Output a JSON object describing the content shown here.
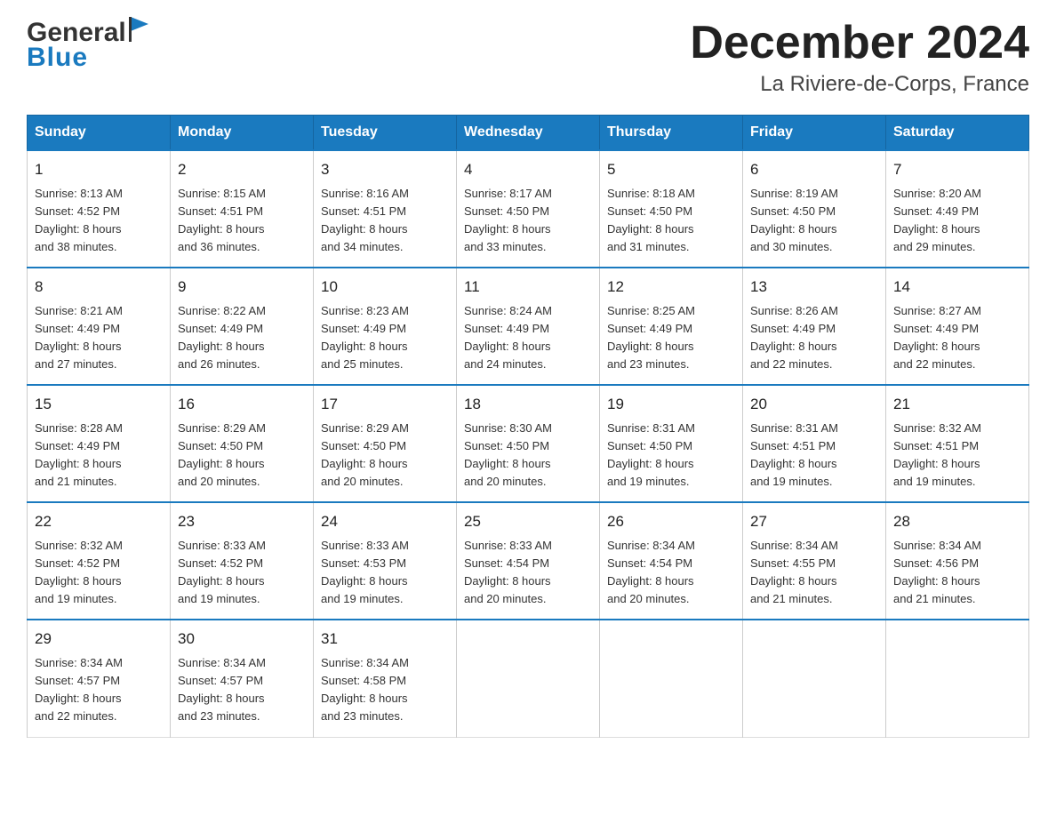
{
  "logo": {
    "general_text": "General",
    "blue_text": "Blue"
  },
  "title": "December 2024",
  "subtitle": "La Riviere-de-Corps, France",
  "weekdays": [
    "Sunday",
    "Monday",
    "Tuesday",
    "Wednesday",
    "Thursday",
    "Friday",
    "Saturday"
  ],
  "weeks": [
    [
      {
        "day": "1",
        "sunrise": "8:13 AM",
        "sunset": "4:52 PM",
        "daylight": "8 hours and 38 minutes."
      },
      {
        "day": "2",
        "sunrise": "8:15 AM",
        "sunset": "4:51 PM",
        "daylight": "8 hours and 36 minutes."
      },
      {
        "day": "3",
        "sunrise": "8:16 AM",
        "sunset": "4:51 PM",
        "daylight": "8 hours and 34 minutes."
      },
      {
        "day": "4",
        "sunrise": "8:17 AM",
        "sunset": "4:50 PM",
        "daylight": "8 hours and 33 minutes."
      },
      {
        "day": "5",
        "sunrise": "8:18 AM",
        "sunset": "4:50 PM",
        "daylight": "8 hours and 31 minutes."
      },
      {
        "day": "6",
        "sunrise": "8:19 AM",
        "sunset": "4:50 PM",
        "daylight": "8 hours and 30 minutes."
      },
      {
        "day": "7",
        "sunrise": "8:20 AM",
        "sunset": "4:49 PM",
        "daylight": "8 hours and 29 minutes."
      }
    ],
    [
      {
        "day": "8",
        "sunrise": "8:21 AM",
        "sunset": "4:49 PM",
        "daylight": "8 hours and 27 minutes."
      },
      {
        "day": "9",
        "sunrise": "8:22 AM",
        "sunset": "4:49 PM",
        "daylight": "8 hours and 26 minutes."
      },
      {
        "day": "10",
        "sunrise": "8:23 AM",
        "sunset": "4:49 PM",
        "daylight": "8 hours and 25 minutes."
      },
      {
        "day": "11",
        "sunrise": "8:24 AM",
        "sunset": "4:49 PM",
        "daylight": "8 hours and 24 minutes."
      },
      {
        "day": "12",
        "sunrise": "8:25 AM",
        "sunset": "4:49 PM",
        "daylight": "8 hours and 23 minutes."
      },
      {
        "day": "13",
        "sunrise": "8:26 AM",
        "sunset": "4:49 PM",
        "daylight": "8 hours and 22 minutes."
      },
      {
        "day": "14",
        "sunrise": "8:27 AM",
        "sunset": "4:49 PM",
        "daylight": "8 hours and 22 minutes."
      }
    ],
    [
      {
        "day": "15",
        "sunrise": "8:28 AM",
        "sunset": "4:49 PM",
        "daylight": "8 hours and 21 minutes."
      },
      {
        "day": "16",
        "sunrise": "8:29 AM",
        "sunset": "4:50 PM",
        "daylight": "8 hours and 20 minutes."
      },
      {
        "day": "17",
        "sunrise": "8:29 AM",
        "sunset": "4:50 PM",
        "daylight": "8 hours and 20 minutes."
      },
      {
        "day": "18",
        "sunrise": "8:30 AM",
        "sunset": "4:50 PM",
        "daylight": "8 hours and 20 minutes."
      },
      {
        "day": "19",
        "sunrise": "8:31 AM",
        "sunset": "4:50 PM",
        "daylight": "8 hours and 19 minutes."
      },
      {
        "day": "20",
        "sunrise": "8:31 AM",
        "sunset": "4:51 PM",
        "daylight": "8 hours and 19 minutes."
      },
      {
        "day": "21",
        "sunrise": "8:32 AM",
        "sunset": "4:51 PM",
        "daylight": "8 hours and 19 minutes."
      }
    ],
    [
      {
        "day": "22",
        "sunrise": "8:32 AM",
        "sunset": "4:52 PM",
        "daylight": "8 hours and 19 minutes."
      },
      {
        "day": "23",
        "sunrise": "8:33 AM",
        "sunset": "4:52 PM",
        "daylight": "8 hours and 19 minutes."
      },
      {
        "day": "24",
        "sunrise": "8:33 AM",
        "sunset": "4:53 PM",
        "daylight": "8 hours and 19 minutes."
      },
      {
        "day": "25",
        "sunrise": "8:33 AM",
        "sunset": "4:54 PM",
        "daylight": "8 hours and 20 minutes."
      },
      {
        "day": "26",
        "sunrise": "8:34 AM",
        "sunset": "4:54 PM",
        "daylight": "8 hours and 20 minutes."
      },
      {
        "day": "27",
        "sunrise": "8:34 AM",
        "sunset": "4:55 PM",
        "daylight": "8 hours and 21 minutes."
      },
      {
        "day": "28",
        "sunrise": "8:34 AM",
        "sunset": "4:56 PM",
        "daylight": "8 hours and 21 minutes."
      }
    ],
    [
      {
        "day": "29",
        "sunrise": "8:34 AM",
        "sunset": "4:57 PM",
        "daylight": "8 hours and 22 minutes."
      },
      {
        "day": "30",
        "sunrise": "8:34 AM",
        "sunset": "4:57 PM",
        "daylight": "8 hours and 23 minutes."
      },
      {
        "day": "31",
        "sunrise": "8:34 AM",
        "sunset": "4:58 PM",
        "daylight": "8 hours and 23 minutes."
      },
      null,
      null,
      null,
      null
    ]
  ],
  "sunrise_label": "Sunrise:",
  "sunset_label": "Sunset:",
  "daylight_label": "Daylight:"
}
